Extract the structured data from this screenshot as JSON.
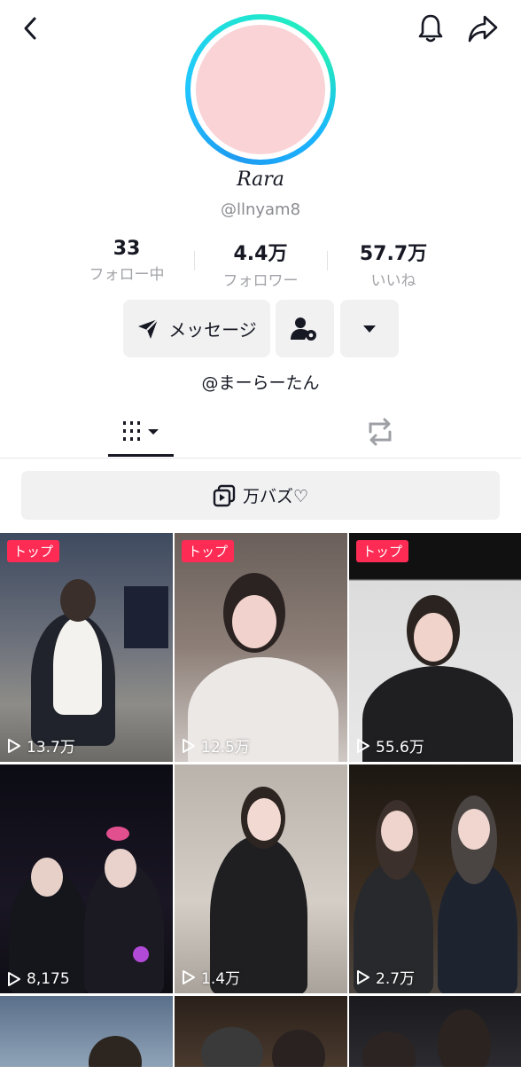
{
  "header": {
    "back_icon": "chevron-left-icon",
    "bell_icon": "bell-icon",
    "share_icon": "share-arrow-icon"
  },
  "profile": {
    "display_name": "Rara",
    "username": "@llnyam8",
    "stats": [
      {
        "value": "33",
        "label": "フォロー中"
      },
      {
        "value": "4.4万",
        "label": "フォロワー"
      },
      {
        "value": "57.7万",
        "label": "いいね"
      }
    ],
    "message_button": "メッセージ",
    "bio": "@まーらーたん",
    "colors": {
      "accent": "#fe2c55",
      "ring_start": "#1e9bf0",
      "ring_end": "#24f0b6",
      "avatar": "#f9d3d6"
    }
  },
  "tabs": {
    "videos_icon": "grid-lines-icon",
    "reposts_icon": "repost-icon"
  },
  "playlist": {
    "label": "万バズ♡"
  },
  "videos": [
    {
      "badge": "トップ",
      "views": "13.7万"
    },
    {
      "badge": "トップ",
      "views": "12.5万"
    },
    {
      "badge": "トップ",
      "views": "55.6万"
    },
    {
      "badge": "",
      "views": "8,175"
    },
    {
      "badge": "",
      "views": "1.4万"
    },
    {
      "badge": "",
      "views": "2.7万"
    }
  ]
}
